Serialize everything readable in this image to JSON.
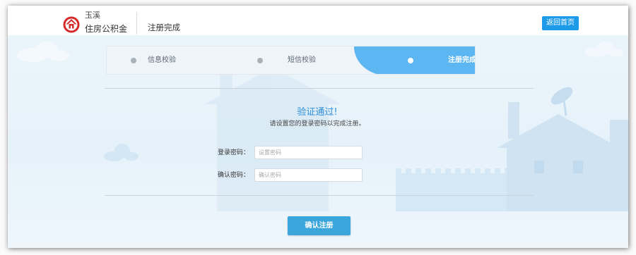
{
  "header": {
    "logo_city": "玉溪",
    "logo_org": "住房公积金",
    "title": "注册完成",
    "home_button": "返回首页"
  },
  "steps": {
    "items": [
      {
        "label": "信息校验"
      },
      {
        "label": "短信校验"
      },
      {
        "label": "注册完成"
      }
    ],
    "active_index": 2
  },
  "main": {
    "success_title": "验证通过!",
    "instruction": "请设置您的登录密码以完成注册。"
  },
  "form": {
    "password": {
      "label": "登录密码：",
      "placeholder": "设置密码"
    },
    "confirm_password": {
      "label": "确认密码：",
      "placeholder": "确认密码"
    },
    "submit_button": "确认注册"
  },
  "icons": {
    "logo": "housing-fund-logo-icon",
    "step_dot": "step-dot-icon"
  },
  "colors": {
    "accent": "#1e9be8",
    "step_active": "#5cb6f2",
    "submit": "#3aa6dc",
    "title": "#2f8fdb",
    "content_bg": "#e6f2fa",
    "logo_red": "#d42a2a"
  }
}
